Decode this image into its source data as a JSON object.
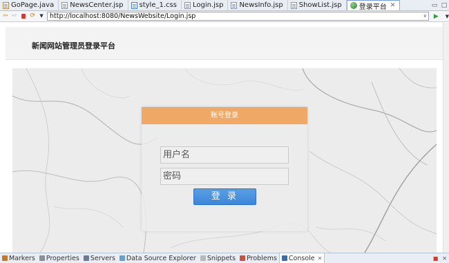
{
  "editor_tabs": [
    {
      "label": "GoPage.java",
      "kind": "java"
    },
    {
      "label": "NewsCenter.jsp",
      "kind": "jsp"
    },
    {
      "label": "style_1.css",
      "kind": "css"
    },
    {
      "label": "Login.jsp",
      "kind": "jsp"
    },
    {
      "label": "NewsInfo.jsp",
      "kind": "jsp"
    },
    {
      "label": "ShowList.jsp",
      "kind": "jsp"
    },
    {
      "label": "登录平台",
      "kind": "browser",
      "active": true
    }
  ],
  "browser": {
    "url": "http://localhost:8080/NewsWebsite/Login.jsp"
  },
  "page": {
    "site_title": "新闻网站管理员登录平台",
    "panel_title": "账号登录",
    "username_placeholder": "用户名",
    "password_placeholder": "密码",
    "login_button": "登 录"
  },
  "views": [
    {
      "label": "Markers",
      "icon": "markers-icon",
      "color": "#c07a2e"
    },
    {
      "label": "Properties",
      "icon": "properties-icon",
      "color": "#8a8f99"
    },
    {
      "label": "Servers",
      "icon": "servers-icon",
      "color": "#6a7b96"
    },
    {
      "label": "Data Source Explorer",
      "icon": "data-source-explorer-icon",
      "color": "#6aa0c8"
    },
    {
      "label": "Snippets",
      "icon": "snippets-icon",
      "color": "#b8b8b8"
    },
    {
      "label": "Problems",
      "icon": "problems-icon",
      "color": "#c0554a"
    },
    {
      "label": "Console",
      "icon": "console-icon",
      "color": "#3a6ea5",
      "active": true
    }
  ],
  "colors": {
    "panel_header": "#efa866",
    "login_button": "#3c86d8"
  }
}
